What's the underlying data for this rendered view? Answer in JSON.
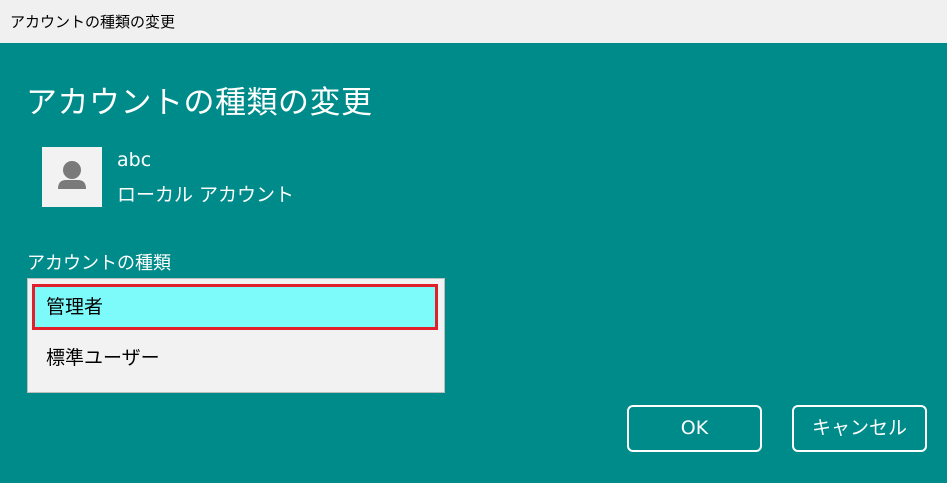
{
  "window": {
    "title": "アカウントの種類の変更"
  },
  "main": {
    "heading": "アカウントの種類の変更",
    "user": {
      "name": "abc",
      "account_type": "ローカル アカウント",
      "avatar_icon": "user-icon"
    },
    "account_type_label": "アカウントの種類",
    "options": [
      {
        "label": "管理者",
        "selected": true
      },
      {
        "label": "標準ユーザー",
        "selected": false
      }
    ]
  },
  "buttons": {
    "ok": "OK",
    "cancel": "キャンセル"
  },
  "colors": {
    "background": "#008b8b",
    "selected_fill": "#7dfbfb",
    "highlight_border": "#e0202b"
  }
}
